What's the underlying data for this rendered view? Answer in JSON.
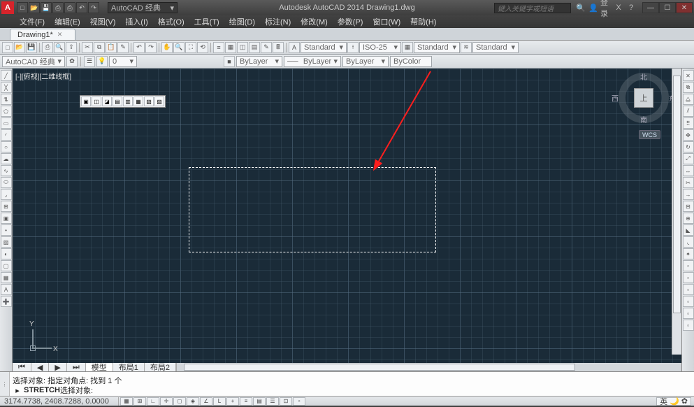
{
  "titlebar": {
    "logo": "A",
    "workspace": "AutoCAD 经典",
    "app_title": "Autodesk AutoCAD 2014   Drawing1.dwg",
    "search_placeholder": "键入关键字或短语",
    "login": "登录"
  },
  "menubar": {
    "items": [
      "文件(F)",
      "编辑(E)",
      "视图(V)",
      "插入(I)",
      "格式(O)",
      "工具(T)",
      "绘图(D)",
      "标注(N)",
      "修改(M)",
      "参数(P)",
      "窗口(W)",
      "帮助(H)"
    ]
  },
  "filetab": {
    "name": "Drawing1*"
  },
  "toolbar2": {
    "style1": "Standard",
    "style2": "ISO-25",
    "style3": "Standard",
    "style4": "Standard"
  },
  "proprow": {
    "workspace": "AutoCAD 经典",
    "layer": "0",
    "prop1": "ByLayer",
    "prop2": "ByLayer",
    "prop3": "ByLayer",
    "prop4": "ByColor"
  },
  "canvas": {
    "viewport_label": "[-][俯视][二维线框]",
    "ucs_y": "Y",
    "ucs_x": "X",
    "cube_face": "上",
    "cube_n": "北",
    "cube_s": "南",
    "cube_e": "东",
    "cube_w": "西",
    "wcs": "WCS"
  },
  "layout_tabs": [
    "模型",
    "布局1",
    "布局2"
  ],
  "command": {
    "line1": "选择对象: 指定对角点: 找到 1 个",
    "line2_cmd": "STRETCH",
    "line2_rest": " 选择对象:"
  },
  "statusbar": {
    "coords": "3174.7738, 2408.7288, 0.0000",
    "ime": "英"
  }
}
